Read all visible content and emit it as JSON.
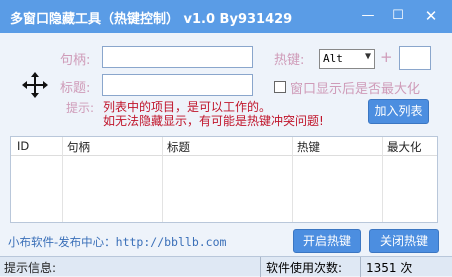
{
  "window": {
    "title": "多窗口隐藏工具（热键控制） v1.0 By931429",
    "min_glyph": "—",
    "max_glyph": "☐",
    "close_glyph": "✕"
  },
  "form": {
    "handle_label": "句柄:",
    "handle_value": "",
    "title_label": "标题:",
    "title_value": "",
    "hotkey_label": "热键:",
    "hotkey_select": "Alt",
    "hotkey_plus": "+",
    "hotkey_key": "",
    "maximize_label": "窗口显示后是否最大化",
    "maximize_checked": false,
    "add_button": "加入列表"
  },
  "tips": {
    "prefix": "提示:",
    "line1": "列表中的项目，是可以工作的。",
    "line2": "如无法隐藏显示，有可能是热键冲突问题!"
  },
  "table": {
    "columns": [
      "ID",
      "句柄",
      "标题",
      "热键",
      "最大化"
    ],
    "rows": []
  },
  "footer": {
    "link_label": "小布软件-发布中心：",
    "link_url": "http://bbllb.com",
    "start_button": "开启热键",
    "stop_button": "关闭热键"
  },
  "status": {
    "tip_label": "提示信息:",
    "uses_label": "软件使用次数:",
    "uses_count": "1351 次"
  },
  "colors": {
    "titlebar": "#5a9ce6",
    "button": "#4c8ee0",
    "warning": "#c0142a"
  }
}
